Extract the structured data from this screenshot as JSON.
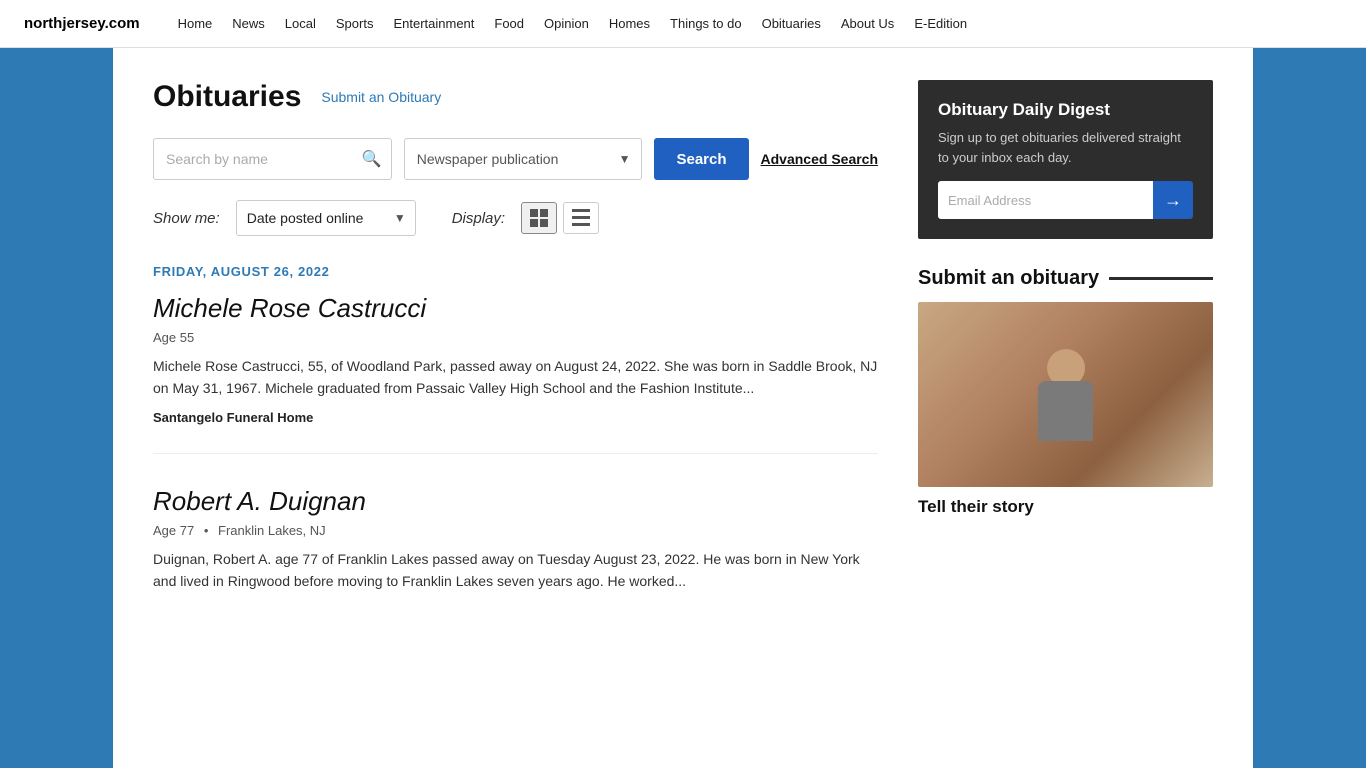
{
  "site": {
    "brand": "northjersey.com"
  },
  "nav": {
    "links": [
      {
        "label": "Home",
        "id": "home"
      },
      {
        "label": "News",
        "id": "news"
      },
      {
        "label": "Local",
        "id": "local"
      },
      {
        "label": "Sports",
        "id": "sports"
      },
      {
        "label": "Entertainment",
        "id": "entertainment"
      },
      {
        "label": "Food",
        "id": "food"
      },
      {
        "label": "Opinion",
        "id": "opinion"
      },
      {
        "label": "Homes",
        "id": "homes"
      },
      {
        "label": "Things to do",
        "id": "things-to-do"
      },
      {
        "label": "Obituaries",
        "id": "obituaries"
      },
      {
        "label": "About Us",
        "id": "about"
      },
      {
        "label": "E-Edition",
        "id": "e-edition"
      }
    ]
  },
  "page": {
    "title": "Obituaries",
    "submit_link": "Submit an Obituary"
  },
  "search": {
    "name_placeholder": "Search by name",
    "newspaper_placeholder": "Newspaper publication",
    "search_btn_label": "Search",
    "advanced_link": "Advanced Search"
  },
  "filters": {
    "show_me_label": "Show me:",
    "show_me_value": "Date posted online",
    "display_label": "Display:"
  },
  "date_section": {
    "date_label": "FRIDAY, AUGUST 26, 2022"
  },
  "obituaries": [
    {
      "name": "Michele Rose Castrucci",
      "age": "Age 55",
      "location": "",
      "excerpt": "Michele Rose Castrucci, 55, of Woodland Park, passed away on August 24, 2022. She was born in Saddle Brook, NJ on May 31, 1967. Michele graduated from Passaic Valley High School and the Fashion Institute...",
      "funeral": "Santangelo Funeral Home"
    },
    {
      "name": "Robert A. Duignan",
      "age": "Age 77",
      "location": "Franklin Lakes, NJ",
      "excerpt": "Duignan, Robert A. age 77 of Franklin Lakes passed away on Tuesday August 23, 2022. He was born in New York and lived in Ringwood before moving to Franklin Lakes seven years ago. He worked...",
      "funeral": ""
    }
  ],
  "sidebar": {
    "digest": {
      "title": "Obituary Daily Digest",
      "description": "Sign up to get obituaries delivered straight to your inbox each day.",
      "email_placeholder": "Email Address",
      "submit_arrow": "→"
    },
    "submit": {
      "title": "Submit an obituary",
      "tell_story": "Tell their story"
    }
  }
}
